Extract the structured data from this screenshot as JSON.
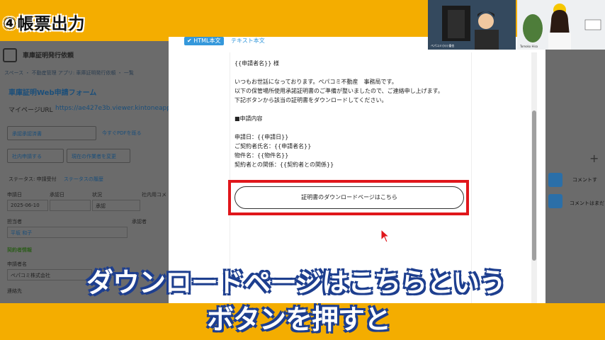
{
  "section_title": "④帳票出力",
  "app": {
    "name": "車庫証明発行依頼",
    "breadcrumb": "スペース ・ 不動産管理 アプリ: 車庫証明発行依頼 ・ 一覧",
    "form_title": "車庫証明Web申請フォーム",
    "mypage_label": "マイページURL",
    "mypage_url": "https://ae427e3b.viewer.kintoneapp.com",
    "select_approval": "承認承認済書",
    "button_pdf": "今すぐPDFを既る",
    "select_request": "社内申請する",
    "select_assignee": "現在の作業者を変更",
    "status_label": "ステータス: 申請受付",
    "status_history": "ステータスの履歴",
    "fields": {
      "date_label": "申請日",
      "approval_label": "承認日",
      "state_label": "状況",
      "memo_label": "社内用コメ",
      "date_value": "2025-06-10",
      "state_value": "承認",
      "owner_label": "担当者",
      "approver_label": "承認者",
      "owner_value": "平坂 和子",
      "contract_section": "契約者情報",
      "applicant_label": "申請者名",
      "applicant_value": "ペパコミ株式会社",
      "contact_label": "連絡先"
    },
    "comments": [
      "コメントす",
      "コメントはまだ"
    ]
  },
  "modal": {
    "tab_html": "✔ HTML本文",
    "tab_text": "テキスト本文",
    "mail_lines": [
      "{{申請者名}} 様",
      "いつもお世話になっております。ペパコミ不動産　事務局です。",
      "以下の保管場所使用承諾証明書のご準備が整いましたので、ご連絡申し上げます。",
      "下記ボタンから該当の証明書をダウンロードしてください。",
      "■申請内容",
      "申請日：{{申請日}}",
      "ご契約者氏名：{{申請者名}}",
      "物件名：{{物件名}}",
      "契約者との関係：{{契約者との関係}}"
    ],
    "download_button": "証明書のダウンロードページはこちら"
  },
  "webcams": {
    "left_name": "ペパコミ小川 優也",
    "right_name": "Tomoko Hisa"
  },
  "captions": {
    "line1": "ダウンロードページはこちらという",
    "line2": "ボタンを押すと"
  },
  "colors": {
    "frame": "#f4ad00",
    "highlight": "#e0161b",
    "tab_active": "#3598db",
    "caption_stroke": "#1e3f8f"
  }
}
